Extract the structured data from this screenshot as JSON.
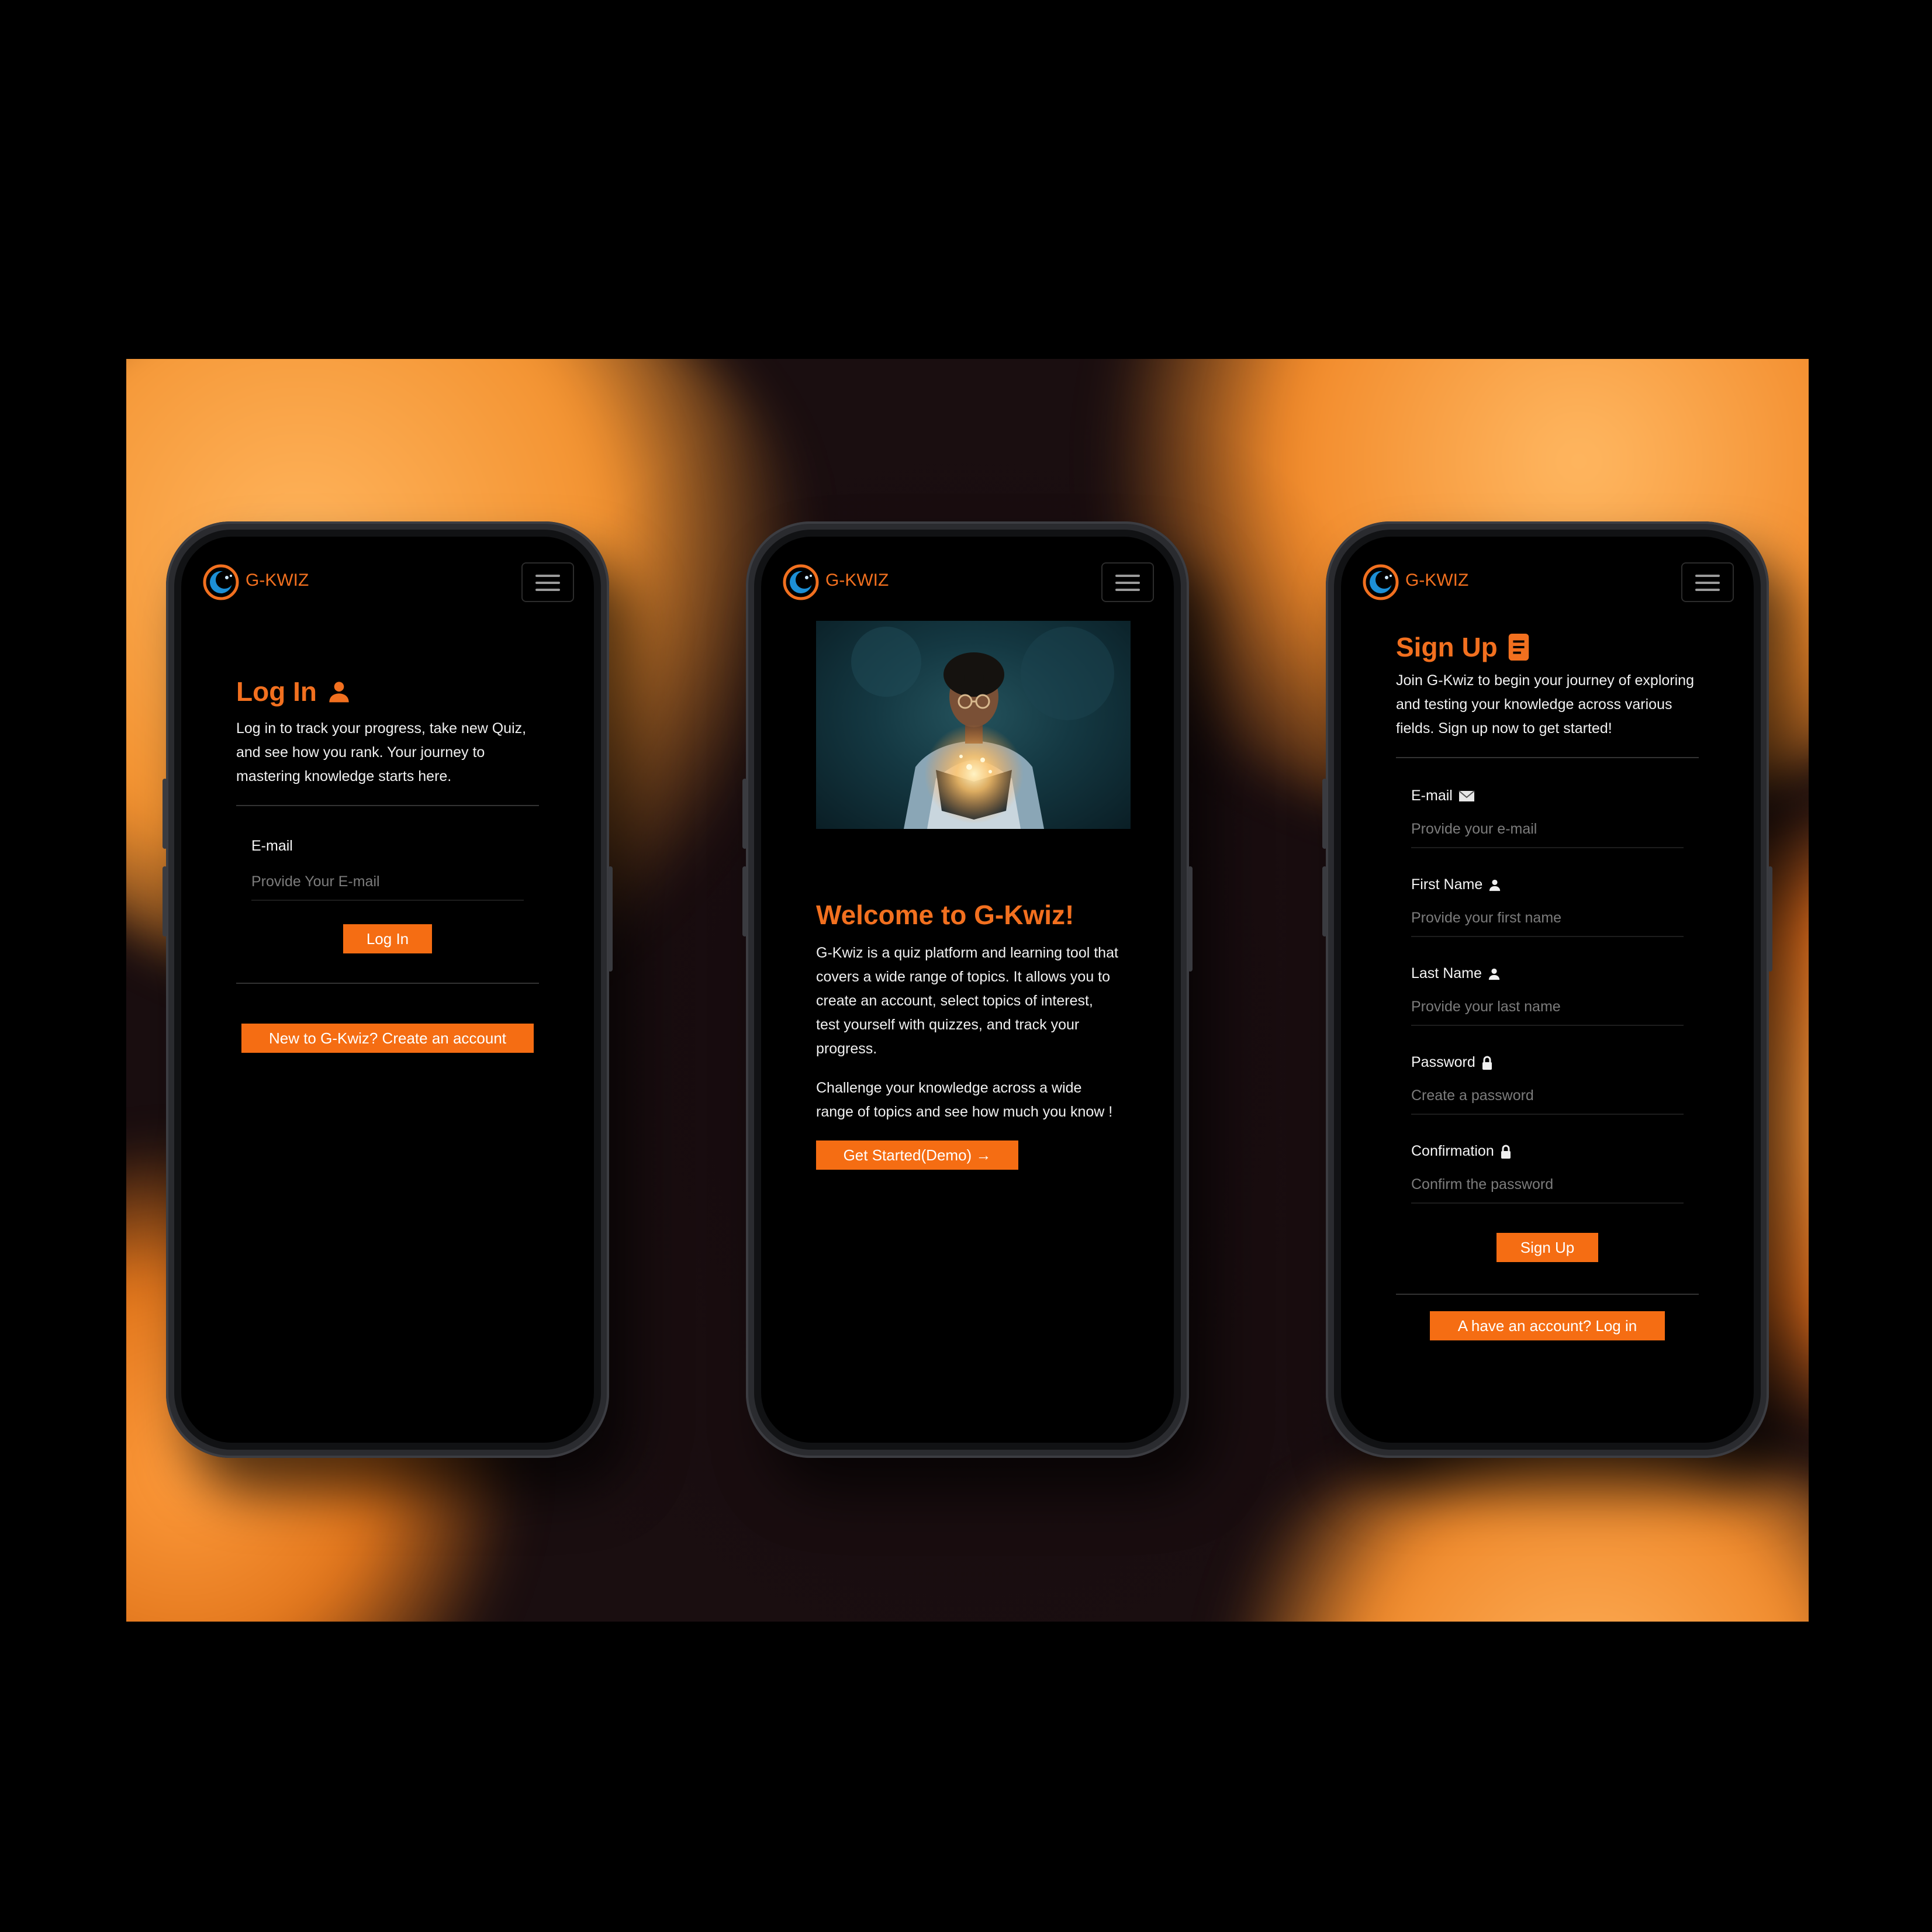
{
  "brand": {
    "name": "G-KWIZ"
  },
  "colors": {
    "accent": "#f56d13",
    "background": "#000000",
    "backdrop_orange": "#f39230"
  },
  "login": {
    "title": "Log In",
    "title_icon": "user-icon",
    "description": "Log in to track your progress, take new Quiz, and see how you rank. Your journey to mastering knowledge starts here.",
    "email_label": "E-mail",
    "email_placeholder": "Provide Your E-mail",
    "submit_label": "Log In",
    "create_account_label": "New to G-Kwiz? Create an account"
  },
  "welcome": {
    "image_alt": "Person reading a glowing book",
    "title": "Welcome to G-Kwiz!",
    "paragraph1": "G-Kwiz is a quiz platform and learning tool that covers a wide range of topics. It allows you to create an account, select topics of interest, test yourself with quizzes, and track your progress.",
    "paragraph2": "Challenge your knowledge across a wide range of topics and see how much you know !",
    "cta_label": "Get Started(Demo) →"
  },
  "signup": {
    "title": "Sign Up",
    "title_icon": "document-icon",
    "description": "Join G-Kwiz to begin your journey of exploring and testing your knowledge across various fields. Sign up now to get started!",
    "fields": [
      {
        "label": "E-mail",
        "icon": "envelope-icon",
        "placeholder": "Provide your e-mail"
      },
      {
        "label": "First Name",
        "icon": "user-icon",
        "placeholder": "Provide your first name"
      },
      {
        "label": "Last Name",
        "icon": "user-icon",
        "placeholder": "Provide your last name"
      },
      {
        "label": "Password",
        "icon": "lock-icon",
        "placeholder": "Create a password"
      },
      {
        "label": "Confirmation",
        "icon": "lock-icon",
        "placeholder": "Confirm the password"
      }
    ],
    "submit_label": "Sign Up",
    "login_link_label": "A have an account? Log in"
  }
}
